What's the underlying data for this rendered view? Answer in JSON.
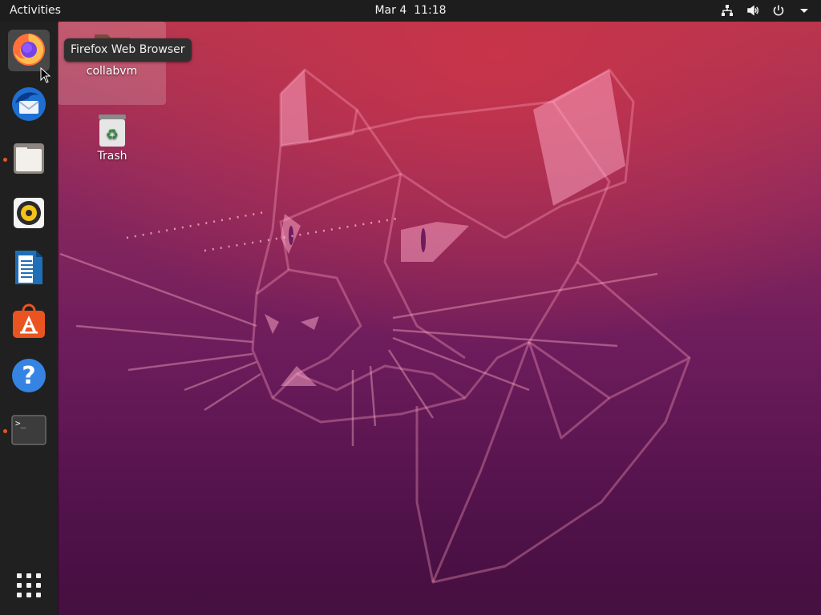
{
  "topbar": {
    "activities_label": "Activities",
    "date": "Mar 4",
    "time": "11:18",
    "tray_icons": [
      "network-icon",
      "volume-icon",
      "power-icon",
      "menu-arrow-icon"
    ]
  },
  "dock": {
    "items": [
      {
        "name": "firefox",
        "icon": "firefox-icon",
        "running": true,
        "active": true
      },
      {
        "name": "thunderbird",
        "icon": "thunderbird-icon",
        "running": false
      },
      {
        "name": "files",
        "icon": "files-icon",
        "running": true
      },
      {
        "name": "rhythmbox",
        "icon": "rhythmbox-icon",
        "running": false
      },
      {
        "name": "libreoffice-writer",
        "icon": "writer-icon",
        "running": false
      },
      {
        "name": "ubuntu-software",
        "icon": "software-icon",
        "running": false
      },
      {
        "name": "help",
        "icon": "help-icon",
        "running": false
      },
      {
        "name": "terminal",
        "icon": "terminal-icon",
        "running": true
      }
    ],
    "show_apps_icon": "app-grid-icon"
  },
  "tooltip": {
    "text": "Firefox Web Browser"
  },
  "desktop": {
    "icons": [
      {
        "label": "collabvm",
        "icon": "folder-icon",
        "selected": true
      },
      {
        "label": "Trash",
        "icon": "trash-icon",
        "selected": false
      }
    ]
  },
  "colors": {
    "accent": "#e95420",
    "topbar": "#1d1d1d",
    "dock": "#202020"
  }
}
